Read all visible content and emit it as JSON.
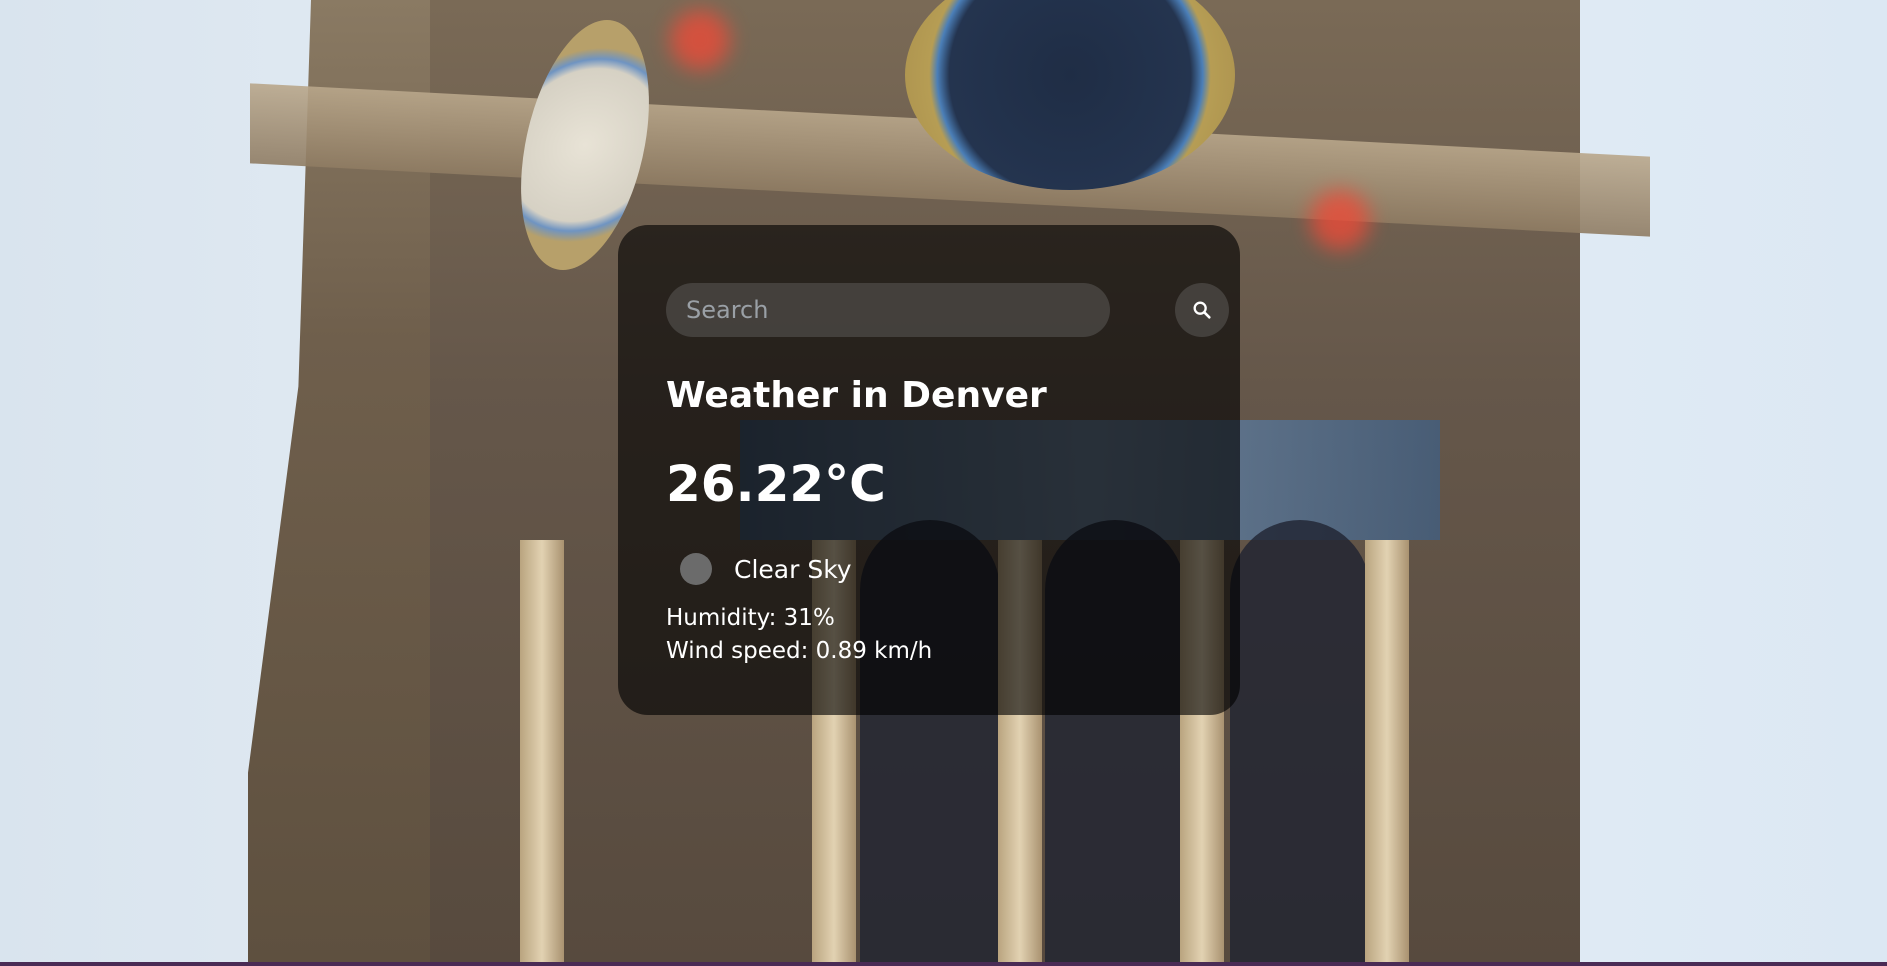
{
  "search": {
    "placeholder": "Search",
    "value": ""
  },
  "weather": {
    "title": "Weather in Denver",
    "temperature": "26.22°C",
    "description": "Clear Sky",
    "humidity": "Humidity: 31%",
    "wind": "Wind speed: 0.89 km/h"
  },
  "icons": {
    "search_button": "search-icon",
    "condition": "weather-condition-icon"
  },
  "colors": {
    "card_background": "#000000",
    "text": "#ffffff",
    "input_background": "#787878"
  }
}
